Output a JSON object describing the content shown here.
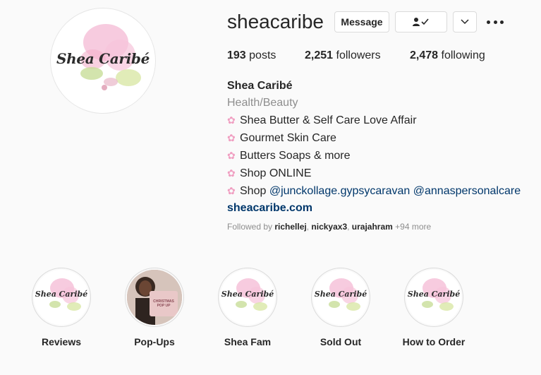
{
  "profile": {
    "username": "sheacaribe",
    "avatar_logo_text": "Shea Caribé",
    "buttons": {
      "message": "Message",
      "follow_icon": "person-check-icon",
      "chevron_icon": "chevron-down-icon",
      "more_icon": "more-options-icon"
    },
    "stats": {
      "posts_count": "193",
      "posts_label": "posts",
      "followers_count": "2,251",
      "followers_label": "followers",
      "following_count": "2,478",
      "following_label": "following"
    },
    "bio": {
      "name": "Shea Caribé",
      "category": "Health/Beauty",
      "lines": [
        "Shea Butter & Self Care Love Affair",
        "Gourmet Skin Care",
        "Butters Soaps & more",
        "Shop ONLINE"
      ],
      "shop_prefix": "Shop",
      "mention_1": "@junckollage.gypsycaravan",
      "mention_2": "@annaspersonalcare",
      "website": "sheacaribe.com"
    },
    "followed_by": {
      "prefix": "Followed by",
      "users": [
        "richellej",
        "nickyax3",
        "urajahram"
      ],
      "more": "+94 more"
    }
  },
  "highlights": [
    {
      "label": "Reviews",
      "logo": "Shea Caribé"
    },
    {
      "label": "Pop-Ups",
      "card_text": "CHRISTMAS POP UP"
    },
    {
      "label": "Shea Fam",
      "logo": "Shea Caribé"
    },
    {
      "label": "Sold Out",
      "logo": "Shea Caribé"
    },
    {
      "label": "How to Order",
      "logo": "Shea Caribé"
    }
  ],
  "colors": {
    "background": "#fafafa",
    "link": "#00376b",
    "muted": "#8e8e8e",
    "text": "#262626",
    "flower": "#f09ec1"
  }
}
